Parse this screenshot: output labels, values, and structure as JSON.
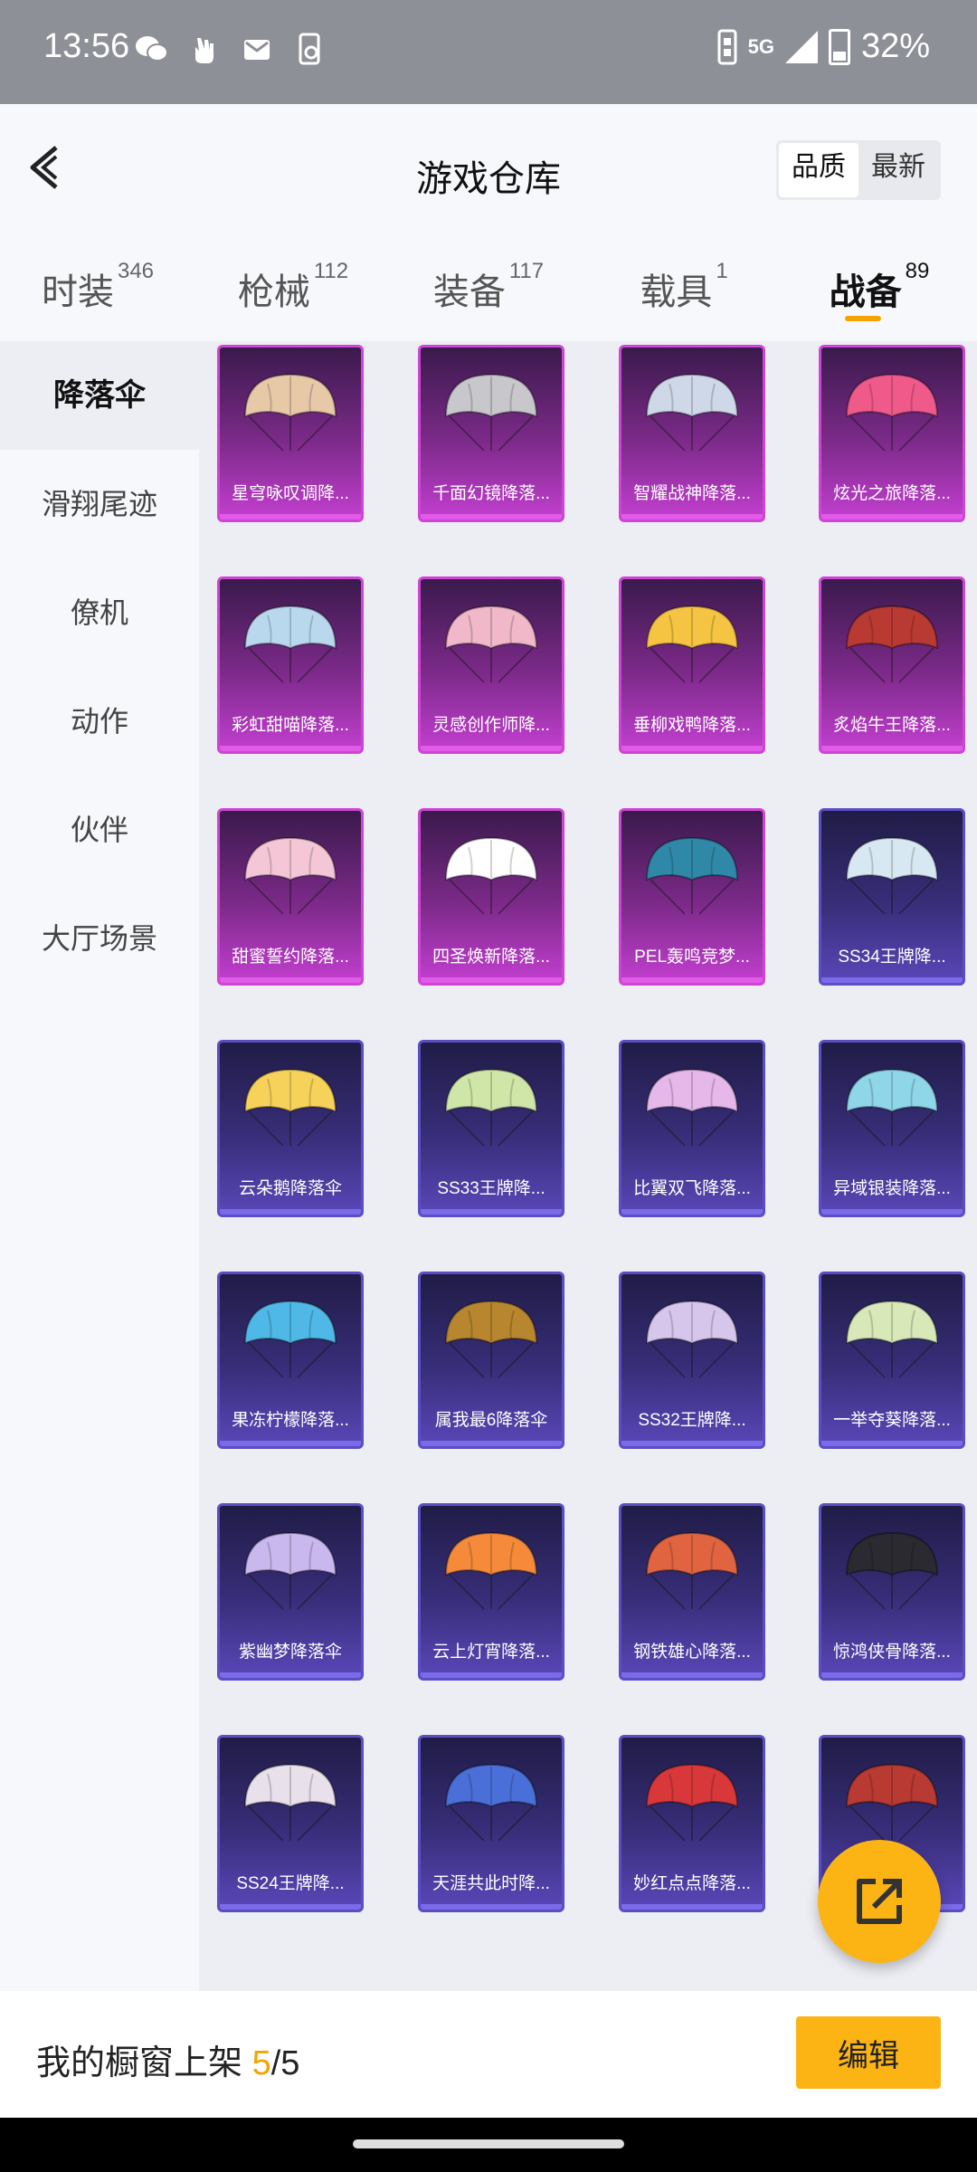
{
  "status_bar": {
    "time": "13:56",
    "network": "5G",
    "battery": "32%"
  },
  "header": {
    "title": "游戏仓库",
    "sort_options": [
      "品质",
      "最新"
    ],
    "sort_selected": "品质"
  },
  "tabs": [
    {
      "label": "时装",
      "count": "346"
    },
    {
      "label": "枪械",
      "count": "112"
    },
    {
      "label": "装备",
      "count": "117"
    },
    {
      "label": "载具",
      "count": "1"
    },
    {
      "label": "战备",
      "count": "89",
      "active": true
    }
  ],
  "sidebar": {
    "items": [
      "降落伞",
      "滑翔尾迹",
      "僚机",
      "动作",
      "伙伴",
      "大厅场景"
    ],
    "active": "降落伞"
  },
  "grid": {
    "items": [
      {
        "label": "星穹咏叹调降...",
        "rarity": "purple",
        "color": "#e7c9a8"
      },
      {
        "label": "千面幻镜降落...",
        "rarity": "purple",
        "color": "#c8c8cc"
      },
      {
        "label": "智耀战神降落...",
        "rarity": "purple",
        "color": "#cfd8e8"
      },
      {
        "label": "炫光之旅降落...",
        "rarity": "purple",
        "color": "#ef5a8a"
      },
      {
        "label": "彩虹甜喵降落...",
        "rarity": "purple",
        "color": "#b9d8ee"
      },
      {
        "label": "灵感创作师降...",
        "rarity": "purple",
        "color": "#f0b8c8"
      },
      {
        "label": "垂柳戏鸭降落...",
        "rarity": "purple",
        "color": "#f6c443"
      },
      {
        "label": "炙焰牛王降落...",
        "rarity": "purple",
        "color": "#b83a32"
      },
      {
        "label": "甜蜜誓约降落...",
        "rarity": "purple",
        "color": "#f4c6d6"
      },
      {
        "label": "四圣焕新降落...",
        "rarity": "purple",
        "color": "#ffffff"
      },
      {
        "label": "PEL轰鸣竞梦...",
        "rarity": "purple",
        "color": "#2f88a8"
      },
      {
        "label": "SS34王牌降...",
        "rarity": "blue",
        "color": "#d8e8f2"
      },
      {
        "label": "云朵鹅降落伞",
        "rarity": "blue",
        "color": "#f7d25a"
      },
      {
        "label": "SS33王牌降...",
        "rarity": "blue",
        "color": "#cfe6a8"
      },
      {
        "label": "比翼双飞降落...",
        "rarity": "blue",
        "color": "#e6b8ea"
      },
      {
        "label": "异域银装降落...",
        "rarity": "blue",
        "color": "#8fd6e8"
      },
      {
        "label": "果冻柠檬降落...",
        "rarity": "blue",
        "color": "#4fb8e6"
      },
      {
        "label": "属我最6降落伞",
        "rarity": "blue",
        "color": "#b8862e"
      },
      {
        "label": "SS32王牌降...",
        "rarity": "blue",
        "color": "#d6c6ec"
      },
      {
        "label": "一举夺葵降落...",
        "rarity": "blue",
        "color": "#d8e8b8"
      },
      {
        "label": "紫幽梦降落伞",
        "rarity": "blue",
        "color": "#c9b8ee"
      },
      {
        "label": "云上灯宵降落...",
        "rarity": "blue",
        "color": "#f48a3a"
      },
      {
        "label": "钢铁雄心降落...",
        "rarity": "blue",
        "color": "#e06440"
      },
      {
        "label": "惊鸿侠骨降落...",
        "rarity": "blue",
        "color": "#2a2a30"
      },
      {
        "label": "SS24王牌降...",
        "rarity": "blue",
        "color": "#e8e0ea"
      },
      {
        "label": "天涯共此时降...",
        "rarity": "blue",
        "color": "#4a6fd8"
      },
      {
        "label": "妙红点点降落...",
        "rarity": "blue",
        "color": "#d8383a"
      },
      {
        "label": "",
        "rarity": "blue",
        "color": "#b83a32"
      }
    ]
  },
  "fab": {
    "icon": "share-external-icon"
  },
  "bottom_bar": {
    "text": "我的橱窗上架",
    "current": "5",
    "total": "/5",
    "edit_label": "编辑"
  }
}
